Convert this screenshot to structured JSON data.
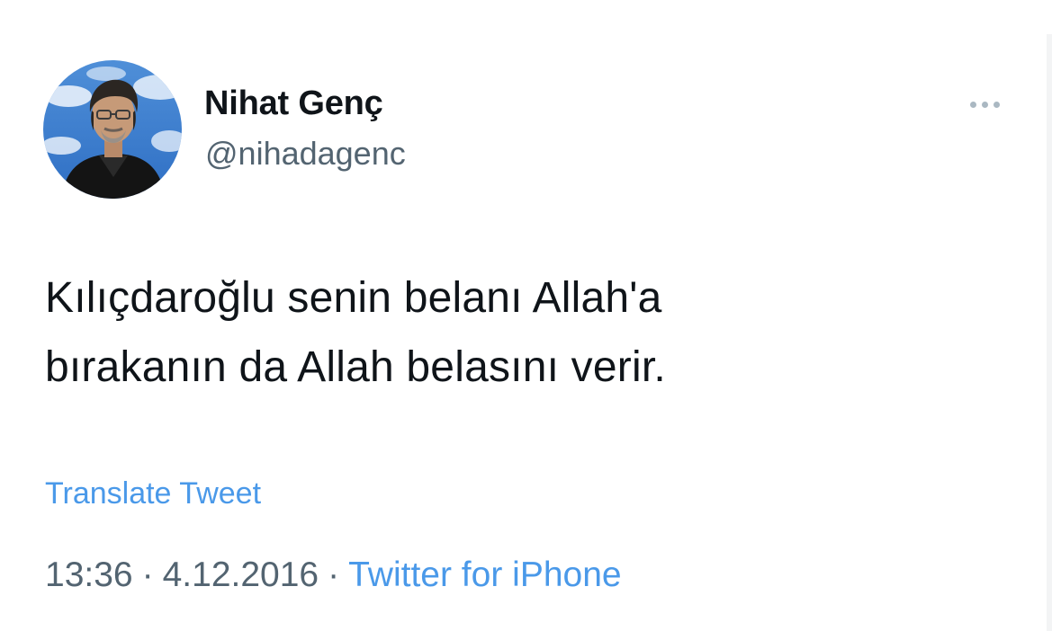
{
  "tweet": {
    "author": {
      "display_name": "Nihat Genç",
      "handle": "@nihadagenc"
    },
    "text_lines": [
      "Kılıçdaroğlu senin belanı Allah'a",
      "bırakanın da Allah belasını verir."
    ],
    "translate_label": "Translate Tweet",
    "time": "13:36",
    "date": "4.12.2016",
    "separator": "·",
    "source": "Twitter for iPhone",
    "more_icon": "more-horizontal-icon"
  },
  "colors": {
    "text": "#0f1419",
    "secondary": "#536471",
    "link": "#4a99e9",
    "more_dots": "#aab8c2"
  }
}
